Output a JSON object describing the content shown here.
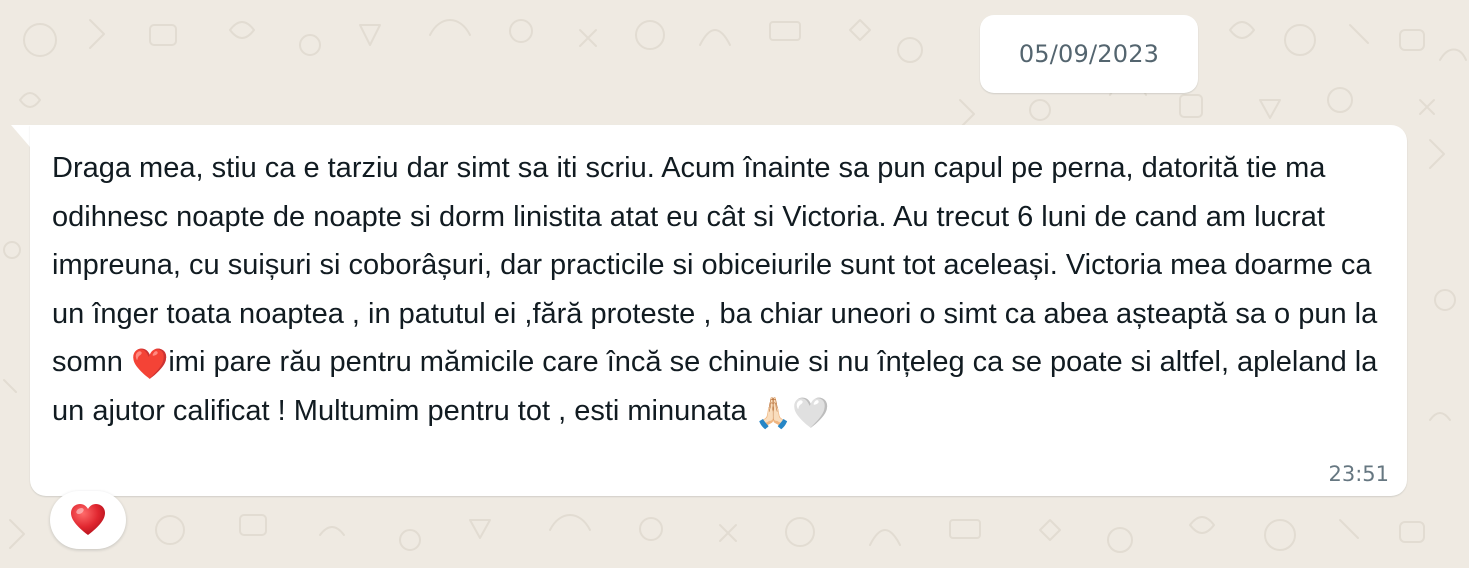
{
  "theme": {
    "chat_background": "#efeae2",
    "bubble_color": "#ffffff",
    "text_color": "#111b21",
    "meta_color": "#667781",
    "heart_color": "#e0262f"
  },
  "date_separator": "05/09/2023",
  "message": {
    "direction": "incoming",
    "parts": [
      "Draga mea, stiu ca e tarziu dar simt sa iti scriu. Acum înainte sa pun capul pe perna, datorită tie ma odihnesc noapte de noapte si dorm linistita atat eu cât si Victoria. Au trecut 6 luni de cand am lucrat impreuna, cu suișuri si coborâșuri, dar practicile si obiceiurile sunt tot aceleași. Victoria mea doarme ca un înger toata noaptea , in patutul ei ,fără proteste , ba chiar uneori o simt ca abea așteaptă sa o pun la somn ",
      "❤️",
      "imi pare rău pentru mămicile care încă se chinuie si nu înțeleg ca se poate si altfel, apleland la un ajutor calificat ! Multumim pentru tot , esti minunata ",
      "🙏🏻",
      "🤍"
    ],
    "time": "23:51",
    "reaction": {
      "emoji": "❤️",
      "icon": "red-heart-icon"
    }
  }
}
